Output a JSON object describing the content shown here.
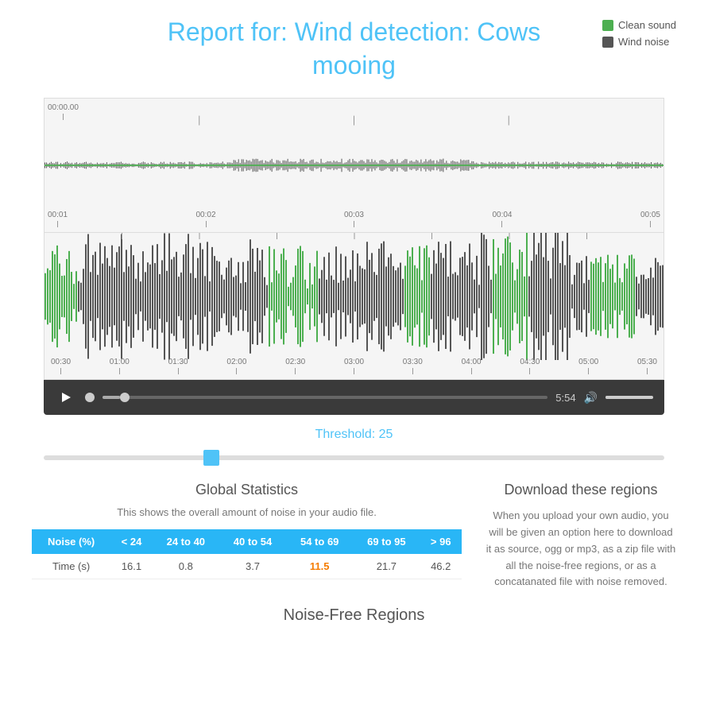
{
  "header": {
    "title_line1": "Report for: Wind detection: Cows",
    "title_line2": "mooing"
  },
  "legend": {
    "clean_sound_label": "Clean sound",
    "wind_noise_label": "Wind noise",
    "clean_color": "#4caf50",
    "dark_color": "#555555"
  },
  "overview_markers_top": [
    "00:00.00"
  ],
  "overview_markers_bottom": [
    "00:01",
    "00:02",
    "00:03",
    "00:04",
    "00:05"
  ],
  "detail_markers": [
    "00:30",
    "01:00",
    "01:30",
    "02:00",
    "02:30",
    "03:00",
    "03:30",
    "04:00",
    "04:30",
    "05:00",
    "05:30"
  ],
  "player": {
    "time": "5:54",
    "progress_percent": 4
  },
  "threshold": {
    "label": "Threshold: 25",
    "value": 25
  },
  "global_stats": {
    "title": "Global Statistics",
    "subtitle": "This shows the overall amount of noise in your audio file.",
    "columns": [
      "Noise (%)",
      "< 24",
      "24 to 40",
      "40 to 54",
      "54 to 69",
      "69 to 95",
      "> 96"
    ],
    "rows": [
      {
        "label": "Time (s)",
        "values": [
          "16.1",
          "0.8",
          "3.7",
          "11.5",
          "21.7",
          "46.2"
        ],
        "highlight_index": 3
      }
    ]
  },
  "download": {
    "title": "Download these regions",
    "text": "When you upload your own audio, you will be given an option here to download it as source, ogg or mp3, as a zip file with all the noise-free regions, or as a concatanated file with noise removed."
  },
  "noise_free": {
    "title": "Noise-Free Regions"
  }
}
